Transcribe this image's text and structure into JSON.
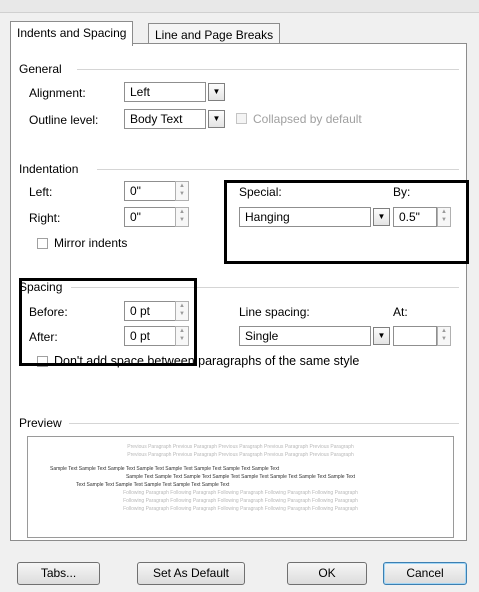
{
  "tabs": [
    "Indents and Spacing",
    "Line and Page Breaks"
  ],
  "general": {
    "heading": "General",
    "alignment_label": "Alignment:",
    "alignment_value": "Left",
    "outline_label": "Outline level:",
    "outline_value": "Body Text",
    "collapsed_label": "Collapsed by default"
  },
  "indentation": {
    "heading": "Indentation",
    "left_label": "Left:",
    "left_value": "0\"",
    "right_label": "Right:",
    "right_value": "0\"",
    "special_label": "Special:",
    "special_value": "Hanging",
    "by_label": "By:",
    "by_value": "0.5\"",
    "mirror_label": "Mirror indents"
  },
  "spacing": {
    "heading": "Spacing",
    "before_label": "Before:",
    "before_value": "0 pt",
    "after_label": "After:",
    "after_value": "0 pt",
    "line_spacing_label": "Line spacing:",
    "line_spacing_value": "Single",
    "at_label": "At:",
    "at_value": "",
    "dont_add_label": "Don't add space between paragraphs of the same style"
  },
  "preview": {
    "heading": "Preview",
    "previous_lines": [
      "Previous Paragraph Previous Paragraph Previous Paragraph Previous Paragraph Previous Paragraph",
      "Previous Paragraph Previous Paragraph Previous Paragraph Previous Paragraph Previous Paragraph"
    ],
    "sample_lines": [
      "Sample Text Sample Text Sample Text Sample Text Sample Text Sample Text Sample Text Sample Text",
      "Sample Text Sample Text Sample Text Sample Text Sample Text Sample Text Sample Text Sample Text",
      "Text Sample Text Sample Text Sample Text Sample Text Sample Text"
    ],
    "following_lines": [
      "Following Paragraph Following Paragraph Following Paragraph Following Paragraph Following Paragraph",
      "Following Paragraph Following Paragraph Following Paragraph Following Paragraph Following Paragraph",
      "Following Paragraph Following Paragraph Following Paragraph Following Paragraph Following Paragraph"
    ]
  },
  "buttons": {
    "tabs": "Tabs...",
    "set_default": "Set As Default",
    "ok": "OK",
    "cancel": "Cancel"
  }
}
